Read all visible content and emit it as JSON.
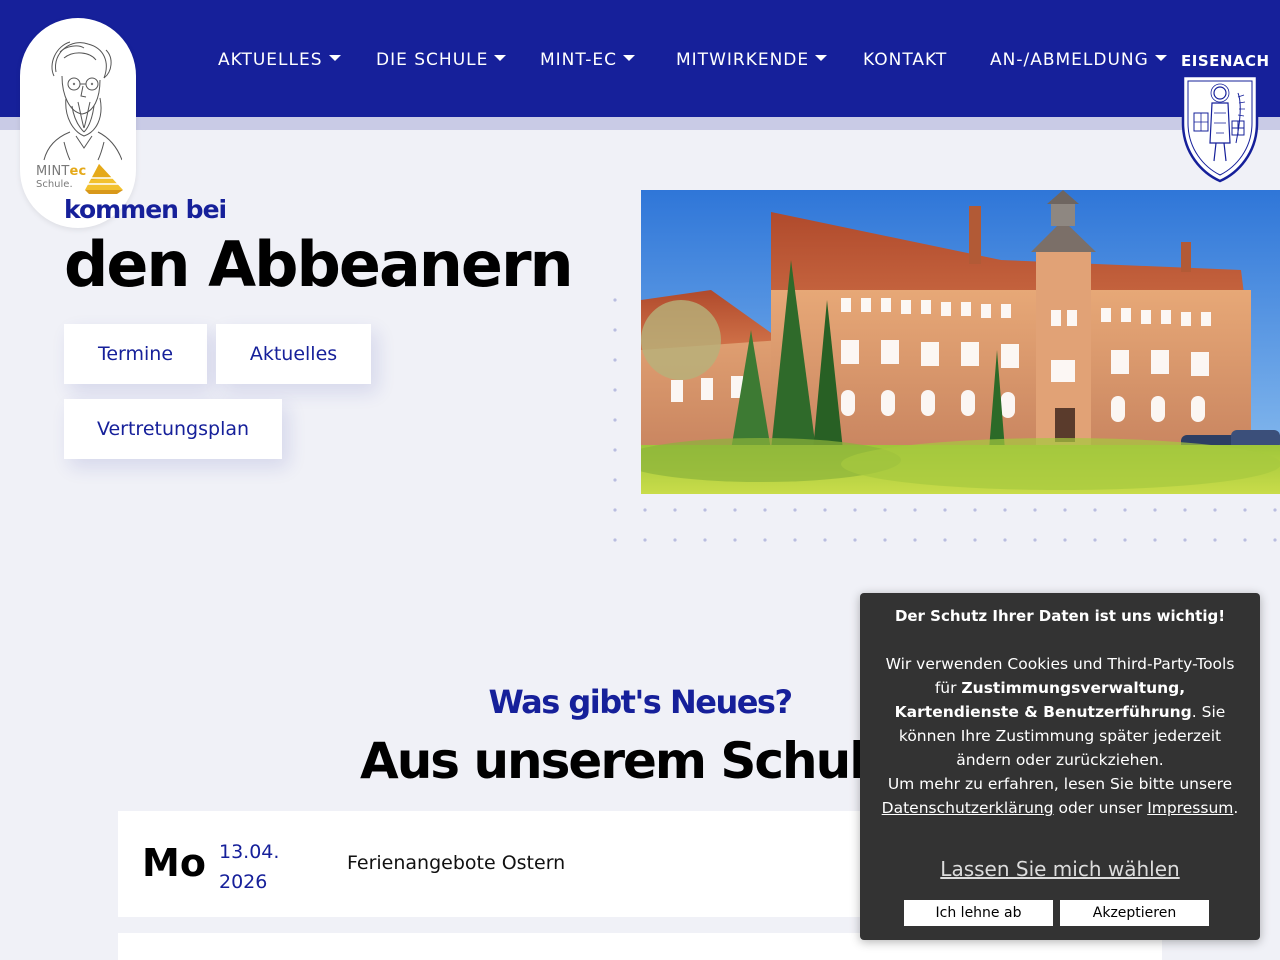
{
  "header": {
    "nav": [
      {
        "label": "AKTUELLES",
        "dropdown": true
      },
      {
        "label": "DIE SCHULE",
        "dropdown": true
      },
      {
        "label": "MINT-EC",
        "dropdown": true
      },
      {
        "label": "MITWIRKENDE",
        "dropdown": true
      },
      {
        "label": "KONTAKT",
        "dropdown": false
      },
      {
        "label": "AN-/ABMELDUNG",
        "dropdown": true
      }
    ],
    "city_label": "EISENACH",
    "mintec_logo": {
      "line1_a": "MINT",
      "line1_b": "ec",
      "line2": "Schule."
    },
    "colors": {
      "primary": "#16209a",
      "accent": "#e5a91a"
    }
  },
  "hero": {
    "kicker": "kommen bei",
    "title": "den Abbeanern",
    "buttons": {
      "termine": "Termine",
      "aktuelles": "Aktuelles",
      "vertretungsplan": "Vertretungsplan"
    }
  },
  "news": {
    "kicker": "Was gibt's Neues?",
    "title": "Aus unserem Schulleb",
    "events": [
      {
        "day": "Mo",
        "date_line1": "13.04.",
        "date_line2": "2026",
        "title": "Ferienangebote Ostern"
      }
    ]
  },
  "cookie": {
    "heading": "Der Schutz Ihrer Daten ist uns wichtig!",
    "p1_a": "Wir verwenden Cookies und Third-Party-Tools für ",
    "p1_bold": "Zustimmungsverwaltung, Kartendienste & Benutzerführung",
    "p1_b": ". Sie können Ihre Zustimmung später jederzeit ändern oder zurückziehen.",
    "p2_a": "Um mehr zu erfahren, lesen Sie bitte unsere ",
    "privacy_link": "Datenschutzerklärung",
    "p2_b": " oder unser ",
    "imprint_link": "Impressum",
    "p2_c": ".",
    "choose_link": "Lassen Sie mich wählen",
    "reject_button": "Ich lehne ab",
    "accept_button": "Akzeptieren"
  }
}
